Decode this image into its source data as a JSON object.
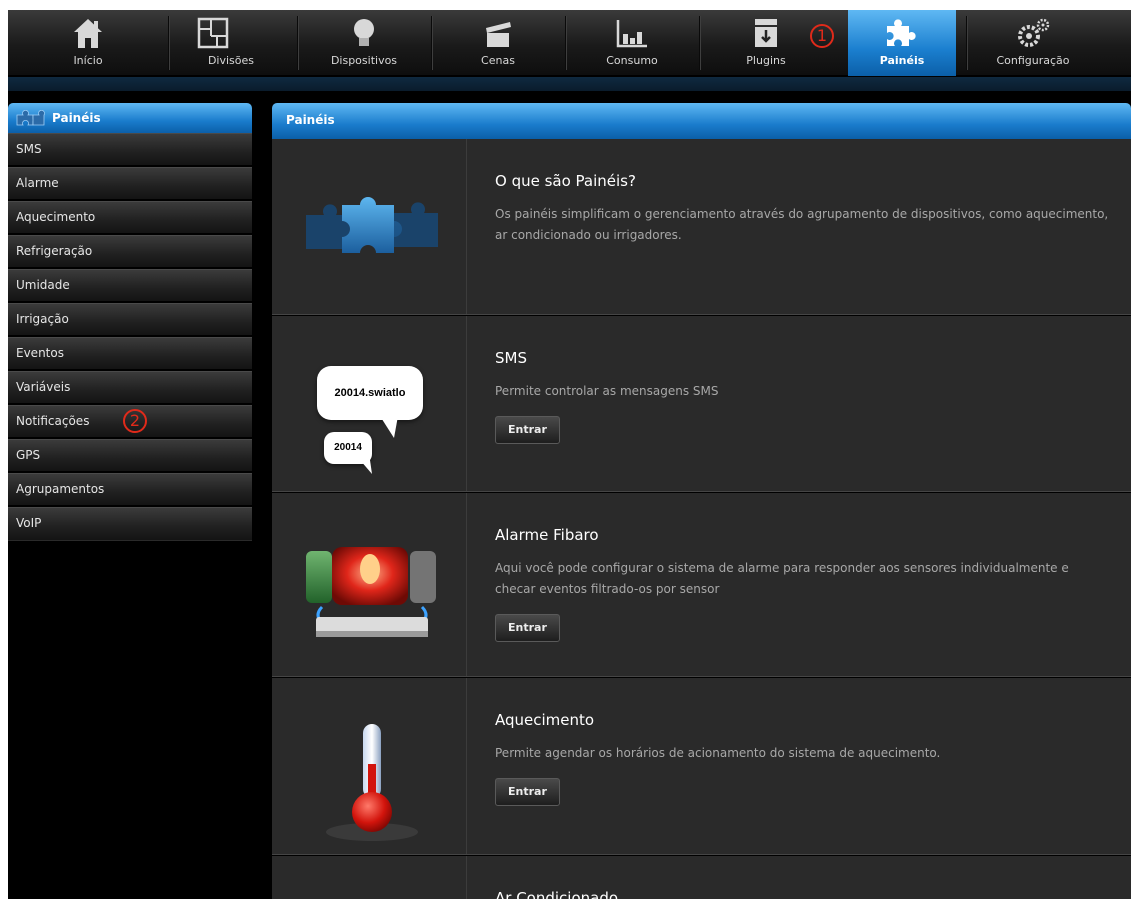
{
  "nav": {
    "items": [
      {
        "label": "Início",
        "icon": "home-icon"
      },
      {
        "label": "Divisões",
        "icon": "floorplan-icon"
      },
      {
        "label": "Dispositivos",
        "icon": "bulb-icon"
      },
      {
        "label": "Cenas",
        "icon": "clapper-icon"
      },
      {
        "label": "Consumo",
        "icon": "chart-icon"
      },
      {
        "label": "Plugins",
        "icon": "box-icon"
      },
      {
        "label": "Painéis",
        "icon": "puzzle-icon",
        "active": true
      },
      {
        "label": "Configuração",
        "icon": "gears-icon"
      }
    ]
  },
  "annotations": {
    "one": "1",
    "two": "2"
  },
  "sidebar": {
    "header": "Painéis",
    "items": [
      "SMS",
      "Alarme",
      "Aquecimento",
      "Refrigeração",
      "Umidade",
      "Irrigação",
      "Eventos",
      "Variáveis",
      "Notificações",
      "GPS",
      "Agrupamentos",
      "VoIP"
    ]
  },
  "main": {
    "header": "Painéis",
    "rows": [
      {
        "title": "O que são Painéis?",
        "desc": "Os painéis simplificam o gerenciamento através do agrupamento de dispositivos, como aquecimento, ar condicionado ou irrigadores.",
        "icon": "puzzle-pieces-icon"
      },
      {
        "title": "SMS",
        "desc": "Permite controlar as mensagens SMS",
        "button": "Entrar",
        "icon": "sms-bubbles-icon",
        "bubble_big": "20014.swiatlo",
        "bubble_small": "20014"
      },
      {
        "title": "Alarme Fibaro",
        "desc": "Aqui você pode configurar o sistema de alarme para responder aos sensores individualmente e checar eventos filtrado-os por sensor",
        "button": "Entrar",
        "icon": "alarm-siren-icon"
      },
      {
        "title": "Aquecimento",
        "desc": "Permite agendar os horários de acionamento do sistema de aquecimento.",
        "button": "Entrar",
        "icon": "thermometer-icon"
      },
      {
        "title": "Ar Condicionado"
      }
    ]
  },
  "colors": {
    "accent": "#1a7ccc",
    "annotation": "#e02a1a"
  }
}
